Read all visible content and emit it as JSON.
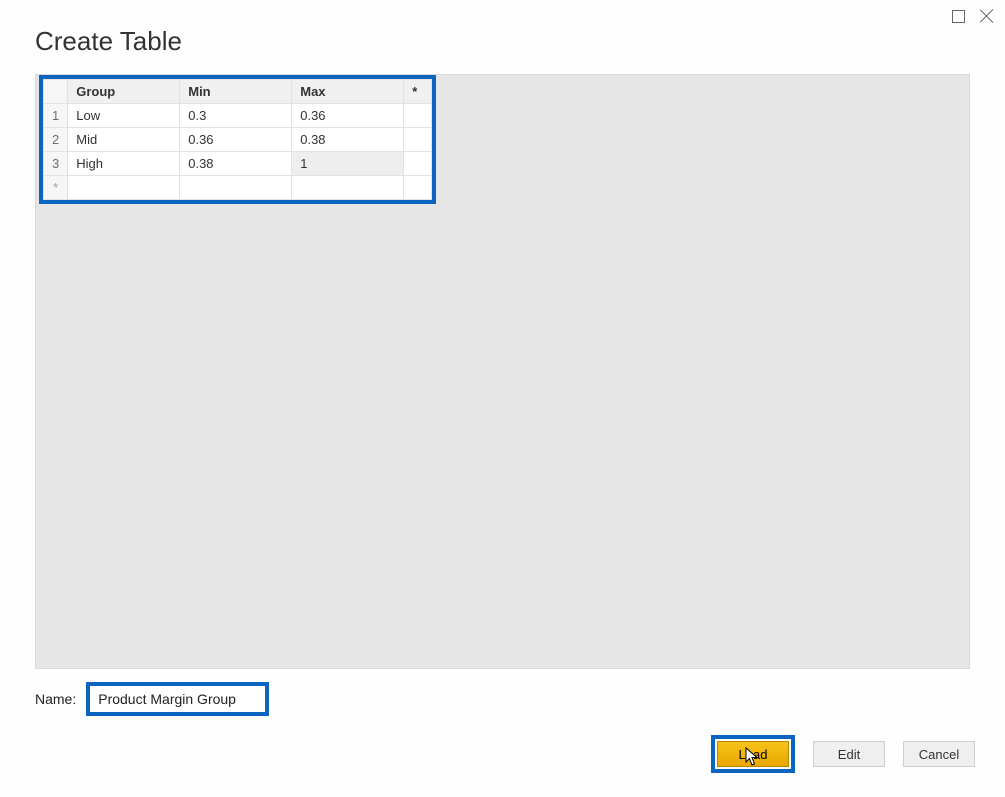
{
  "dialog": {
    "title": "Create Table",
    "name_label": "Name:",
    "name_value": "Product Margin Group"
  },
  "table": {
    "add_col_symbol": "*",
    "new_row_symbol": "*",
    "columns": [
      "Group",
      "Min",
      "Max"
    ],
    "rows": [
      {
        "num": "1",
        "group": "Low",
        "min": "0.3",
        "max": "0.36"
      },
      {
        "num": "2",
        "group": "Mid",
        "min": "0.36",
        "max": "0.38"
      },
      {
        "num": "3",
        "group": "High",
        "min": "0.38",
        "max": "1"
      }
    ]
  },
  "buttons": {
    "load": "Load",
    "edit": "Edit",
    "cancel": "Cancel"
  }
}
